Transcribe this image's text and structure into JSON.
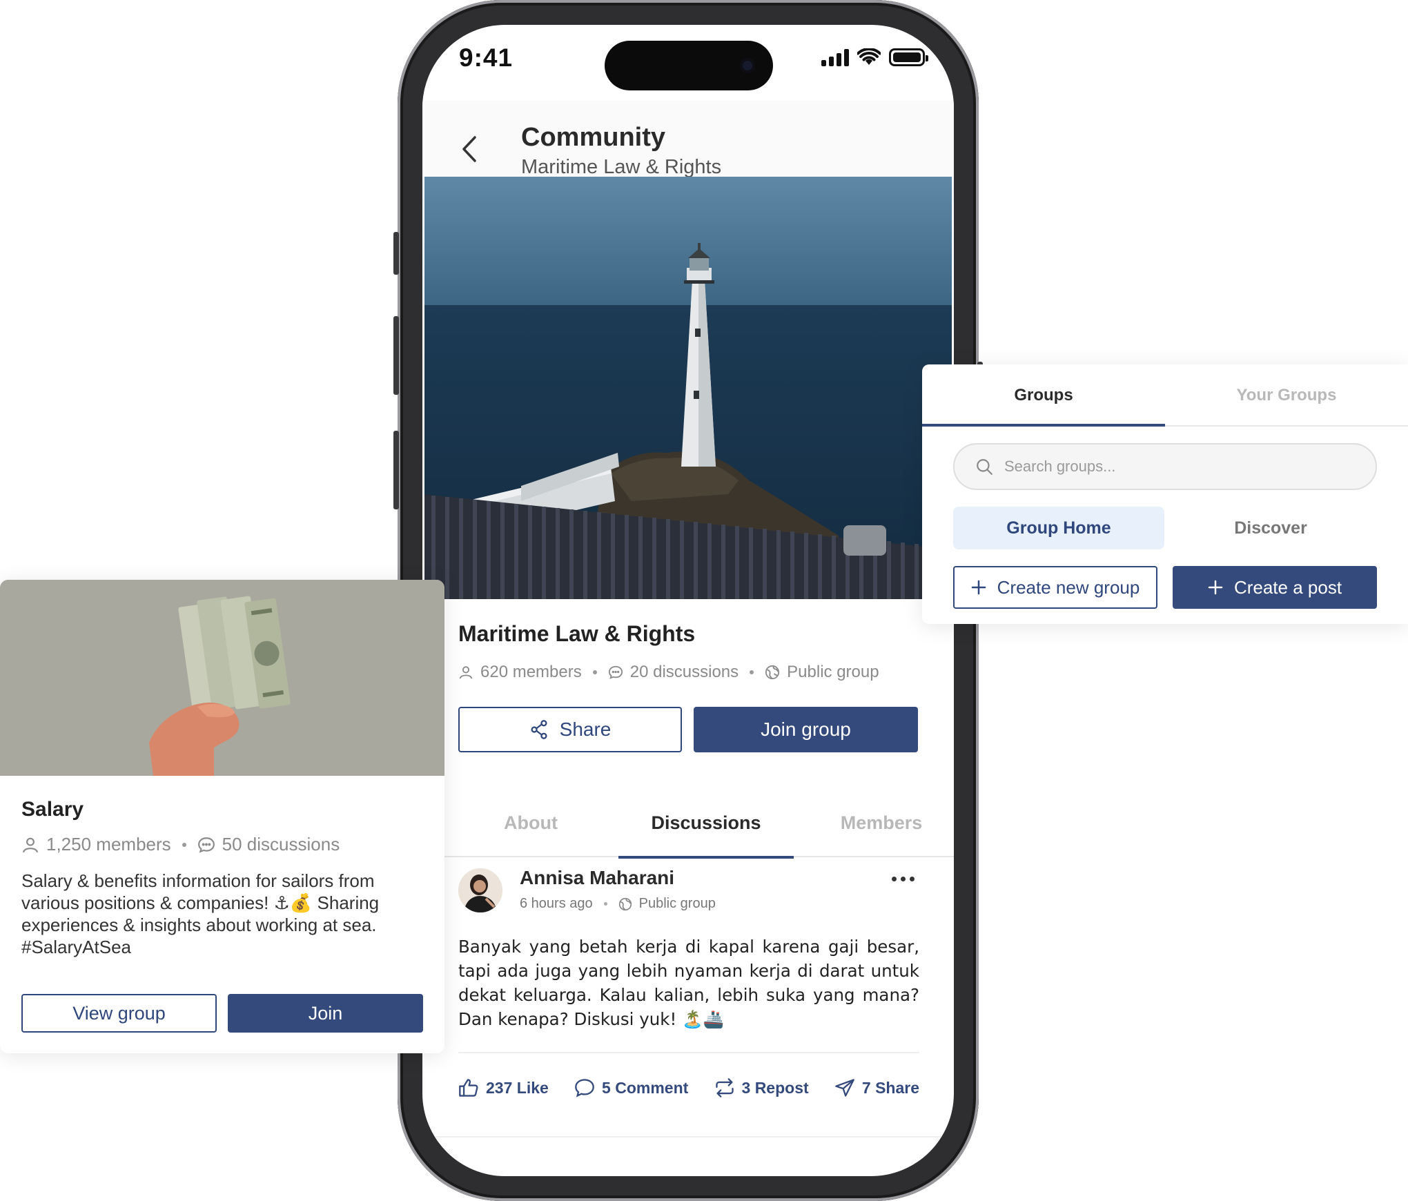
{
  "status": {
    "time": "9:41"
  },
  "header": {
    "title": "Community",
    "subtitle": "Maritime Law & Rights"
  },
  "group": {
    "name": "Maritime Law & Rights",
    "members": "620 members",
    "discussions": "20 discussions",
    "privacy": "Public group",
    "share_label": "Share",
    "join_label": "Join group"
  },
  "tabs": [
    {
      "label": "About"
    },
    {
      "label": "Discussions"
    },
    {
      "label": "Members"
    }
  ],
  "post": {
    "author": "Annisa Maharani",
    "time": "6 hours ago",
    "visibility": "Public group",
    "body": "Banyak yang betah kerja di kapal karena gaji besar, tapi ada juga yang lebih nyaman kerja di darat untuk dekat keluarga. Kalau kalian, lebih suka yang mana? Dan kenapa? Diskusi yuk! 🏝️🚢",
    "actions": {
      "like": "237 Like",
      "comment": "5 Comment",
      "repost": "3 Repost",
      "share": "7 Share"
    }
  },
  "salary_card": {
    "title": "Salary",
    "members": "1,250 members",
    "discussions": "50 discussions",
    "description": "Salary & benefits information for sailors from various positions & companies! ⚓💰 Sharing experiences & insights about working at sea. #SalaryAtSea",
    "view_label": "View group",
    "join_label": "Join"
  },
  "groups_panel": {
    "tabs": [
      "Groups",
      "Your Groups"
    ],
    "search_placeholder": "Search groups...",
    "nav": [
      "Group Home",
      "Discover"
    ],
    "create_group_label": "Create new group",
    "create_post_label": "Create a post"
  },
  "colors": {
    "primary": "#34497c",
    "pill_active_bg": "#e8f1fb",
    "muted": "#8a8a8a"
  }
}
